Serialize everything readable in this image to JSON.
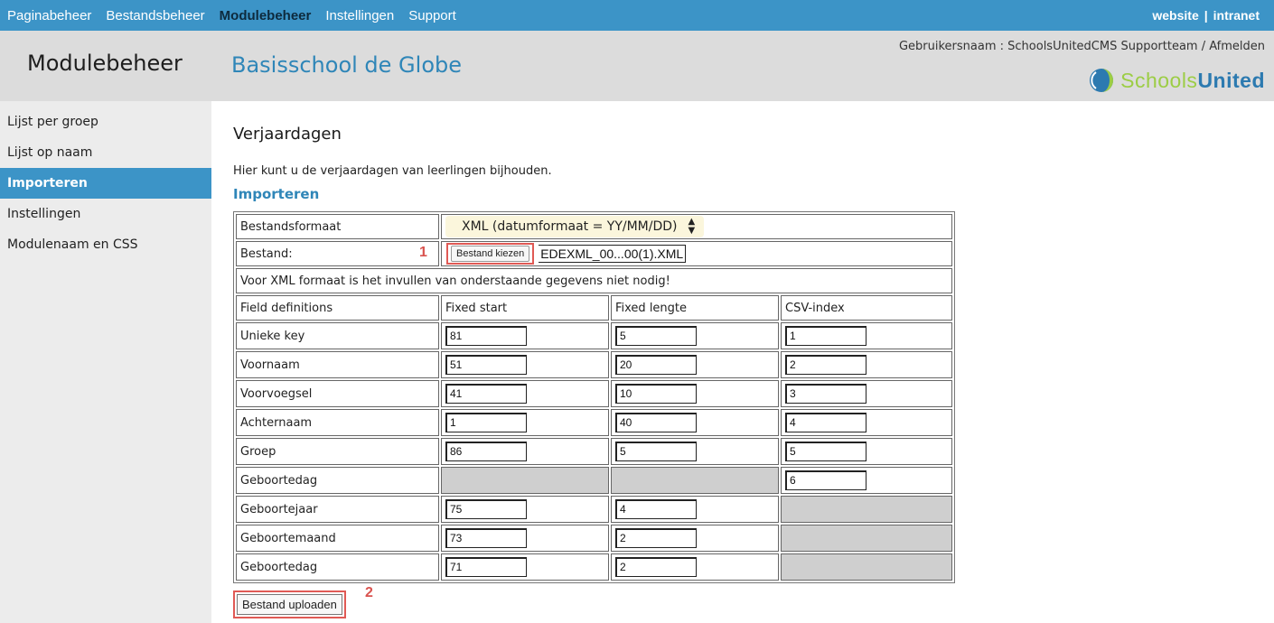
{
  "topnav": {
    "items": [
      {
        "label": "Paginabeheer",
        "active": false
      },
      {
        "label": "Bestandsbeheer",
        "active": false
      },
      {
        "label": "Modulebeheer",
        "active": true
      },
      {
        "label": "Instellingen",
        "active": false
      },
      {
        "label": "Support",
        "active": false
      }
    ],
    "right_links": [
      "website",
      "intranet"
    ],
    "separator": "|"
  },
  "header": {
    "module_title": "Modulebeheer",
    "school_title": "Basisschool de Globe",
    "user_line": "Gebruikersnaam : SchoolsUnitedCMS Supportteam / Afmelden",
    "logo": {
      "part1": "Schools",
      "part2": "United",
      "icon": "schoolsunited-logo-icon"
    }
  },
  "sidebar": {
    "items": [
      {
        "label": "Lijst per groep",
        "active": false
      },
      {
        "label": "Lijst op naam",
        "active": false
      },
      {
        "label": "Importeren",
        "active": true
      },
      {
        "label": "Instellingen",
        "active": false
      },
      {
        "label": "Modulenaam en CSS",
        "active": false
      }
    ]
  },
  "main": {
    "page_title": "Verjaardagen",
    "intro": "Hier kunt u de verjaardagen van leerlingen bijhouden.",
    "section_title": "Importeren",
    "form": {
      "format_label": "Bestandsformaat",
      "format_value": "XML (datumformaat = YY/MM/DD)",
      "file_label": "Bestand:",
      "file_marker": "1",
      "file_button": "Bestand kiezen",
      "file_name": "EDEXML_00...00(1).XML",
      "note": "Voor XML formaat is het invullen van onderstaande gegevens niet nodig!",
      "headers": [
        "Field definitions",
        "Fixed start",
        "Fixed lengte",
        "CSV-index"
      ],
      "rows": [
        {
          "name": "Unieke key",
          "start": "81",
          "length": "5",
          "csv": "1"
        },
        {
          "name": "Voornaam",
          "start": "51",
          "length": "20",
          "csv": "2"
        },
        {
          "name": "Voorvoegsel",
          "start": "41",
          "length": "10",
          "csv": "3"
        },
        {
          "name": "Achternaam",
          "start": "1",
          "length": "40",
          "csv": "4"
        },
        {
          "name": "Groep",
          "start": "86",
          "length": "5",
          "csv": "5"
        },
        {
          "name": "Geboortedag",
          "start": null,
          "length": null,
          "csv": "6"
        },
        {
          "name": "Geboortejaar",
          "start": "75",
          "length": "4",
          "csv": null
        },
        {
          "name": "Geboortemaand",
          "start": "73",
          "length": "2",
          "csv": null
        },
        {
          "name": "Geboortedag",
          "start": "71",
          "length": "2",
          "csv": null
        }
      ]
    },
    "upload_button": "Bestand uploaden",
    "upload_marker": "2"
  }
}
